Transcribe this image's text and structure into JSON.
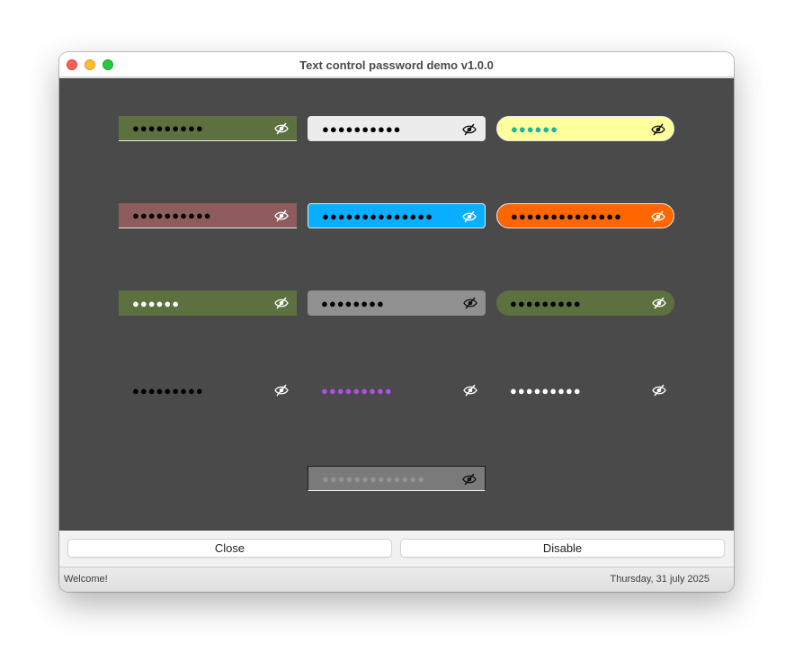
{
  "window": {
    "title": "Text control password demo v1.0.0"
  },
  "icons": {
    "toggle_visibility": "eye-slash-icon"
  },
  "fields": [
    {
      "name": "password-field-olive-flat",
      "value": "●●●●●●●●●",
      "bg": "#5d7040",
      "dot_color": "#000000",
      "style": "flat-underline"
    },
    {
      "name": "password-field-light-gray",
      "value": "●●●●●●●●●●",
      "bg": "#ececec",
      "dot_color": "#000000",
      "style": "rounded-border"
    },
    {
      "name": "password-field-yellow",
      "value": "●●●●●●",
      "bg": "#fefe9c",
      "dot_color": "#13b7a0",
      "style": "pill"
    },
    {
      "name": "password-field-rosy-brown",
      "value": "●●●●●●●●●●",
      "bg": "#8e5c5c",
      "dot_color": "#000000",
      "style": "flat-underline"
    },
    {
      "name": "password-field-sky-blue",
      "value": "●●●●●●●●●●●●●●",
      "bg": "#0aaeff",
      "dot_color": "#000000",
      "style": "rounded-border"
    },
    {
      "name": "password-field-orange",
      "value": "●●●●●●●●●●●●●●",
      "bg": "#ff6600",
      "dot_color": "#000000",
      "style": "pill"
    },
    {
      "name": "password-field-olive-white-dots",
      "value": "●●●●●●",
      "bg": "#5d7040",
      "dot_color": "#ffffff",
      "style": "flat"
    },
    {
      "name": "password-field-medium-gray",
      "value": "●●●●●●●●",
      "bg": "#909090",
      "dot_color": "#000000",
      "style": "rounded"
    },
    {
      "name": "password-field-olive-pill",
      "value": "●●●●●●●●●",
      "bg": "#5d7040",
      "dot_color": "#000000",
      "style": "pill-flat"
    },
    {
      "name": "password-field-transparent-black",
      "value": "●●●●●●●●●",
      "bg": "transparent",
      "dot_color": "#000000",
      "style": "borderless"
    },
    {
      "name": "password-field-transparent-purple",
      "value": "●●●●●●●●●",
      "bg": "transparent",
      "dot_color": "#b04ee6",
      "style": "borderless"
    },
    {
      "name": "password-field-transparent-white",
      "value": "●●●●●●●●●",
      "bg": "transparent",
      "dot_color": "#ffffff",
      "style": "borderless"
    },
    {
      "name": "password-field-disabled",
      "value": "●●●●●●●●●●●●●",
      "bg": "#7a7a7a",
      "dot_color": "#939393",
      "style": "disabled"
    }
  ],
  "buttons": {
    "close": "Close",
    "disable": "Disable"
  },
  "statusbar": {
    "left": "Welcome!",
    "right": "Thursday, 31 july 2025"
  }
}
